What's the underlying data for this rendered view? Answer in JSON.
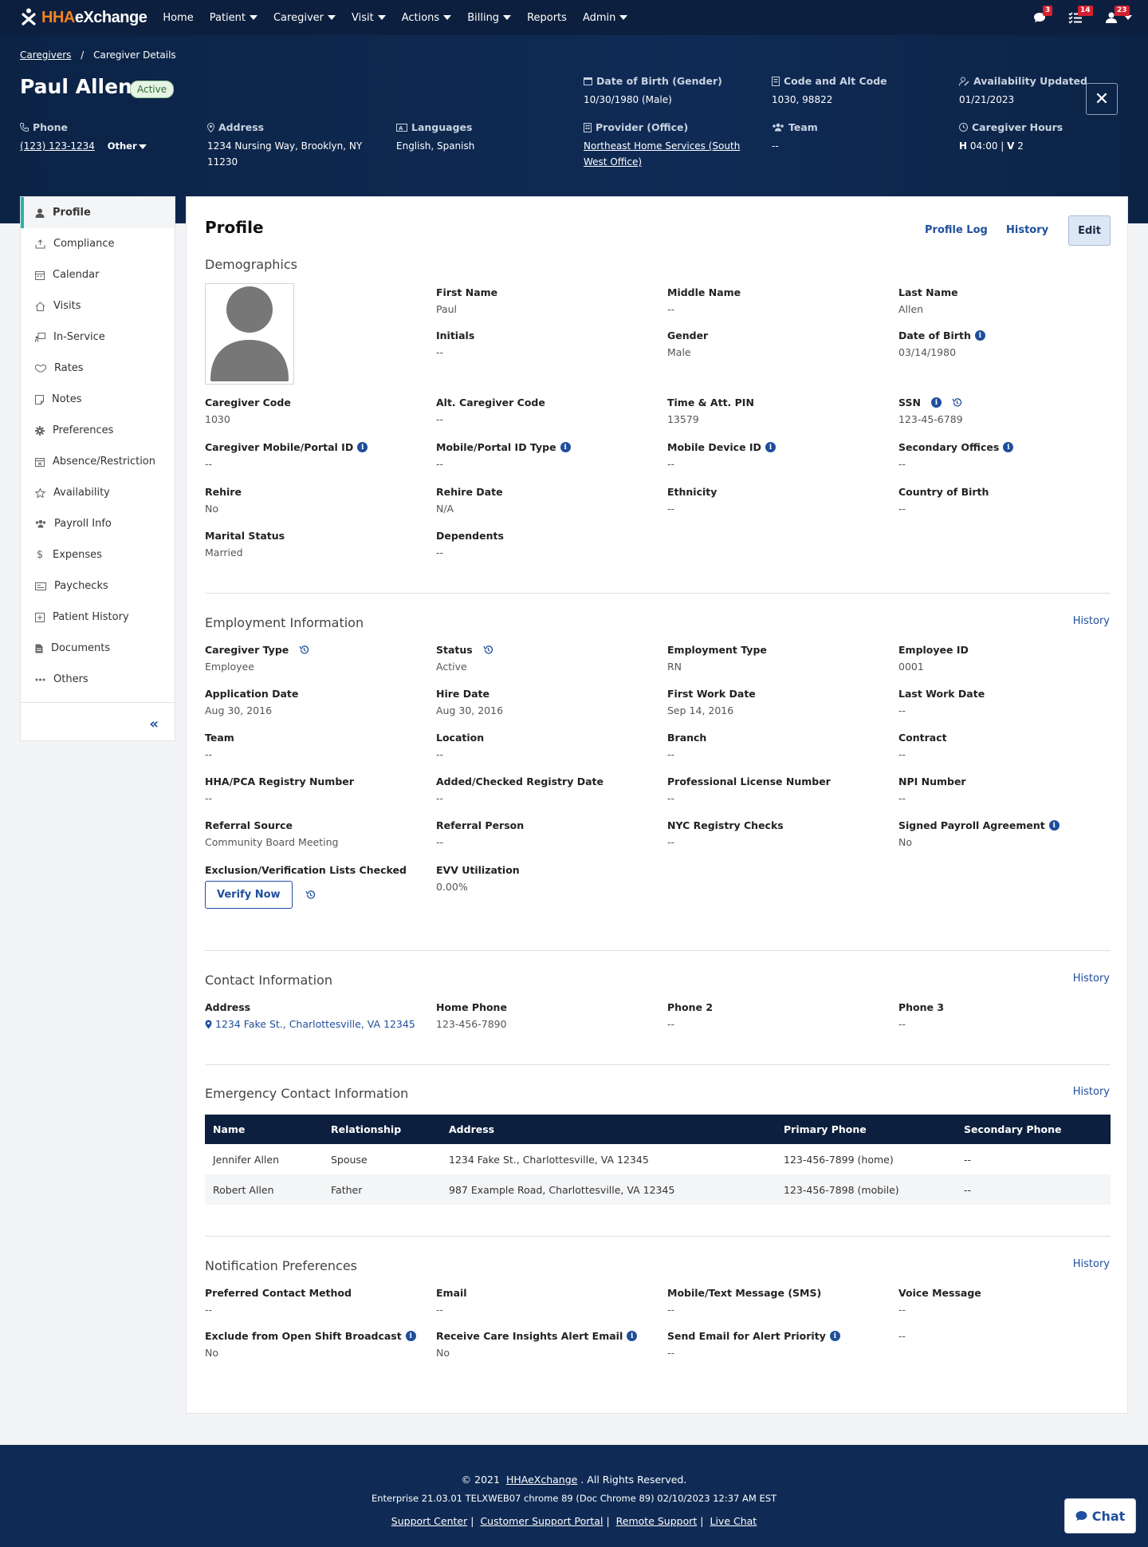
{
  "nav": {
    "logo": {
      "prefix": "HHA",
      "suffix": "eXchange"
    },
    "items": [
      "Home",
      "Patient",
      "Caregiver",
      "Visit",
      "Actions",
      "Billing",
      "Reports",
      "Admin"
    ],
    "badges": {
      "messages": "3",
      "tasks": "14",
      "users": "23"
    }
  },
  "header": {
    "breadcrumb": {
      "link": "Caregivers",
      "current": "Caregiver Details"
    },
    "name": "Paul Allen",
    "status": "Active",
    "dob": {
      "label": "Date of Birth (Gender)",
      "value": "10/30/1980 (Male)"
    },
    "code": {
      "label": "Code and Alt Code",
      "value": "1030, 98822"
    },
    "availability": {
      "label": "Availability Updated",
      "value": "01/21/2023"
    },
    "phone": {
      "label": "Phone",
      "value": "(123) 123-1234",
      "type": "Other"
    },
    "address": {
      "label": "Address",
      "line1": "1234 Nursing Way, Brooklyn, NY",
      "line2": "11230"
    },
    "languages": {
      "label": "Languages",
      "value": "English, Spanish"
    },
    "provider": {
      "label": "Provider (Office)",
      "line1": "Northeast Home Services (South",
      "line2": "West Office)"
    },
    "team": {
      "label": "Team",
      "value": "--"
    },
    "hours": {
      "label": "Caregiver Hours",
      "h": "H",
      "hval": "04:00",
      "sep": "|",
      "v": "V",
      "vval": "2"
    }
  },
  "sidebar": {
    "items": [
      {
        "label": "Profile",
        "icon": "person-icon"
      },
      {
        "label": "Compliance",
        "icon": "upload-icon"
      },
      {
        "label": "Calendar",
        "icon": "calendar-icon"
      },
      {
        "label": "Visits",
        "icon": "home-icon"
      },
      {
        "label": "In-Service",
        "icon": "presentation-icon"
      },
      {
        "label": "Rates",
        "icon": "handshake-icon"
      },
      {
        "label": "Notes",
        "icon": "note-icon"
      },
      {
        "label": "Preferences",
        "icon": "gear-icon"
      },
      {
        "label": "Absence/Restriction",
        "icon": "calendar-x-icon"
      },
      {
        "label": "Availability",
        "icon": "star-icon"
      },
      {
        "label": "Payroll Info",
        "icon": "people-icon"
      },
      {
        "label": "Expenses",
        "icon": "dollar-icon"
      },
      {
        "label": "Paychecks",
        "icon": "check-icon"
      },
      {
        "label": "Patient History",
        "icon": "history-icon"
      },
      {
        "label": "Documents",
        "icon": "document-icon"
      },
      {
        "label": "Others",
        "icon": "dots-icon"
      }
    ],
    "collapse": "«"
  },
  "profile": {
    "title": "Profile",
    "profile_log": "Profile Log",
    "history": "History",
    "edit": "Edit"
  },
  "demographics": {
    "title": "Demographics",
    "first_name": {
      "label": "First Name",
      "value": "Paul"
    },
    "middle_name": {
      "label": "Middle Name",
      "value": "--"
    },
    "last_name": {
      "label": "Last Name",
      "value": "Allen"
    },
    "initials": {
      "label": "Initials",
      "value": "--"
    },
    "gender": {
      "label": "Gender",
      "value": "Male"
    },
    "dob": {
      "label": "Date of Birth",
      "value": "03/14/1980"
    },
    "caregiver_code": {
      "label": "Caregiver Code",
      "value": "1030"
    },
    "alt_code": {
      "label": "Alt. Caregiver Code",
      "value": "--"
    },
    "pin": {
      "label": "Time & Att. PIN",
      "value": "13579"
    },
    "ssn": {
      "label": "SSN",
      "value": "123-45-6789"
    },
    "mobile_portal_id": {
      "label": "Caregiver Mobile/Portal ID",
      "value": "--"
    },
    "mobile_portal_type": {
      "label": "Mobile/Portal ID Type",
      "value": "--"
    },
    "mobile_device_id": {
      "label": "Mobile Device ID",
      "value": "--"
    },
    "secondary_offices": {
      "label": "Secondary Offices",
      "value": "--"
    },
    "rehire": {
      "label": "Rehire",
      "value": "No"
    },
    "rehire_date": {
      "label": "Rehire Date",
      "value": "N/A"
    },
    "ethnicity": {
      "label": "Ethnicity",
      "value": "--"
    },
    "country_of_birth": {
      "label": "Country of Birth",
      "value": "--"
    },
    "marital_status": {
      "label": "Marital Status",
      "value": "Married"
    },
    "dependents": {
      "label": "Dependents",
      "value": "--"
    }
  },
  "employment": {
    "title": "Employment Information",
    "history": "History",
    "caregiver_type": {
      "label": "Caregiver Type",
      "value": "Employee"
    },
    "status": {
      "label": "Status",
      "value": "Active"
    },
    "employment_type": {
      "label": "Employment Type",
      "value": "RN"
    },
    "employee_id": {
      "label": "Employee ID",
      "value": "0001"
    },
    "application_date": {
      "label": "Application Date",
      "value": "Aug 30, 2016"
    },
    "hire_date": {
      "label": "Hire Date",
      "value": "Aug 30, 2016"
    },
    "first_work_date": {
      "label": "First Work Date",
      "value": "Sep 14, 2016"
    },
    "last_work_date": {
      "label": "Last Work Date",
      "value": "--"
    },
    "team": {
      "label": "Team",
      "value": "--"
    },
    "location": {
      "label": "Location",
      "value": "--"
    },
    "branch": {
      "label": "Branch",
      "value": "--"
    },
    "contract": {
      "label": "Contract",
      "value": "--"
    },
    "registry_number": {
      "label": "HHA/PCA Registry Number",
      "value": "--"
    },
    "registry_date": {
      "label": "Added/Checked Registry Date",
      "value": "--"
    },
    "license_number": {
      "label": "Professional License Number",
      "value": "--"
    },
    "npi": {
      "label": "NPI Number",
      "value": "--"
    },
    "referral_source": {
      "label": "Referral Source",
      "value": "Community Board Meeting"
    },
    "referral_person": {
      "label": "Referral Person",
      "value": "--"
    },
    "nyc_registry": {
      "label": "NYC Registry Checks",
      "value": "--"
    },
    "payroll_agreement": {
      "label": "Signed Payroll Agreement",
      "value": "No"
    },
    "exclusion": {
      "label": "Exclusion/Verification Lists Checked",
      "button": "Verify Now"
    },
    "evv": {
      "label": "EVV Utilization",
      "value": "0.00%"
    }
  },
  "contact": {
    "title": "Contact Information",
    "history": "History",
    "address": {
      "label": "Address",
      "value": "1234 Fake St., Charlottesville, VA 12345"
    },
    "home_phone": {
      "label": "Home Phone",
      "value": "123-456-7890"
    },
    "phone2": {
      "label": "Phone 2",
      "value": "--"
    },
    "phone3": {
      "label": "Phone 3",
      "value": "--"
    }
  },
  "emergency": {
    "title": "Emergency Contact Information",
    "history": "History",
    "columns": [
      "Name",
      "Relationship",
      "Address",
      "Primary Phone",
      "Secondary Phone"
    ],
    "rows": [
      [
        "Jennifer Allen",
        "Spouse",
        "1234 Fake St., Charlottesville, VA 12345",
        "123-456-7899 (home)",
        "--"
      ],
      [
        "Robert Allen",
        "Father",
        "987 Example Road, Charlottesville, VA 12345",
        "123-456-7898 (mobile)",
        "--"
      ]
    ]
  },
  "notification": {
    "title": "Notification Preferences",
    "history": "History",
    "preferred_contact": {
      "label": "Preferred Contact Method",
      "value": "--"
    },
    "email": {
      "label": "Email",
      "value": "--"
    },
    "sms": {
      "label": "Mobile/Text Message (SMS)",
      "value": "--"
    },
    "voice": {
      "label": "Voice Message",
      "value": "--"
    },
    "exclude_broadcast": {
      "label": "Exclude from Open Shift Broadcast",
      "value": "No"
    },
    "care_insights": {
      "label": "Receive Care Insights Alert Email",
      "value": "No"
    },
    "alert_priority": {
      "label": "Send Email for Alert Priority",
      "value": "--"
    },
    "extra": "--"
  },
  "footer": {
    "copyright_prefix": "© 2021",
    "copyright_link": "HHAeXchange",
    "copyright_suffix": ". All Rights Reserved.",
    "build": "Enterprise 21.03.01 TELXWEB07 chrome 89 (Doc Chrome 89) 02/10/2023 12:37 AM EST",
    "links": [
      "Support Center",
      "Customer Support Portal",
      "Remote Support",
      "Live Chat"
    ],
    "sep": "|"
  },
  "chat": {
    "label": "Chat"
  },
  "colors": {
    "nav": "#0c1f3e",
    "header": "#0f2b55",
    "accent": "#1f4e9c",
    "active": "#2bb5a6",
    "badge": "#d6202f",
    "brand": "#f58220"
  }
}
